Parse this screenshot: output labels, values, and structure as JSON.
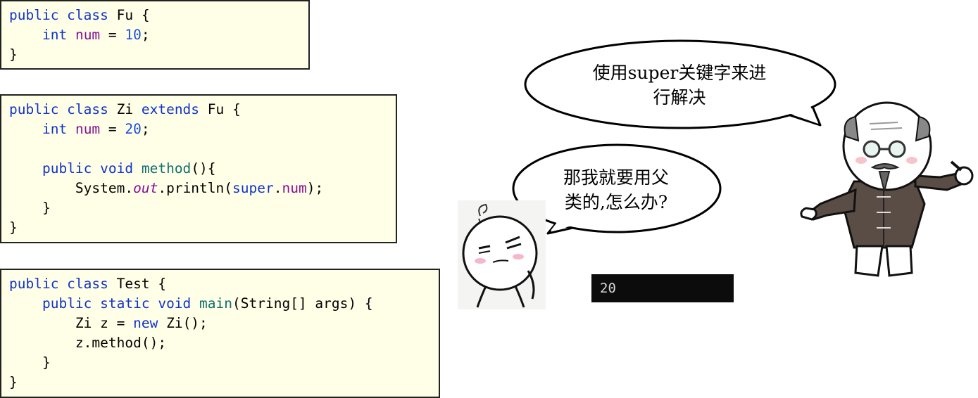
{
  "code_blocks": [
    {
      "id": "fu",
      "lines": [
        [
          [
            "public class",
            "kw"
          ],
          [
            " Fu {",
            "plain"
          ]
        ],
        [
          [
            "    ",
            "plain"
          ],
          [
            "int",
            "kw"
          ],
          [
            " ",
            "plain"
          ],
          [
            "num",
            "fld"
          ],
          [
            " = ",
            "plain"
          ],
          [
            "10",
            "num"
          ],
          [
            ";",
            "plain"
          ]
        ],
        [
          [
            "}",
            "plain"
          ]
        ]
      ]
    },
    {
      "id": "zi",
      "lines": [
        [
          [
            "public class",
            "kw"
          ],
          [
            " Zi ",
            "plain"
          ],
          [
            "extends",
            "kw"
          ],
          [
            " Fu {",
            "plain"
          ]
        ],
        [
          [
            "    ",
            "plain"
          ],
          [
            "int",
            "kw"
          ],
          [
            " ",
            "plain"
          ],
          [
            "num",
            "fld"
          ],
          [
            " = ",
            "plain"
          ],
          [
            "20",
            "num"
          ],
          [
            ";",
            "plain"
          ]
        ],
        [
          [
            "",
            "plain"
          ]
        ],
        [
          [
            "    ",
            "plain"
          ],
          [
            "public void",
            "kw"
          ],
          [
            " ",
            "plain"
          ],
          [
            "method",
            "mth"
          ],
          [
            "(){",
            "plain"
          ]
        ],
        [
          [
            "        System.",
            "plain"
          ],
          [
            "out",
            "fld italic"
          ],
          [
            ".println(",
            "plain"
          ],
          [
            "super",
            "kw"
          ],
          [
            ".",
            "plain"
          ],
          [
            "num",
            "fld"
          ],
          [
            ");",
            "plain"
          ]
        ],
        [
          [
            "    }",
            "plain"
          ]
        ],
        [
          [
            "}",
            "plain"
          ]
        ]
      ]
    },
    {
      "id": "test",
      "lines": [
        [
          [
            "public class",
            "kw"
          ],
          [
            " Test {",
            "plain"
          ]
        ],
        [
          [
            "    ",
            "plain"
          ],
          [
            "public static void",
            "kw"
          ],
          [
            " ",
            "plain"
          ],
          [
            "main",
            "mth"
          ],
          [
            "(String[] args) {",
            "plain"
          ]
        ],
        [
          [
            "        Zi z = ",
            "plain"
          ],
          [
            "new",
            "kw"
          ],
          [
            " Zi();",
            "plain"
          ]
        ],
        [
          [
            "        z.method();",
            "plain"
          ]
        ],
        [
          [
            "    }",
            "plain"
          ]
        ],
        [
          [
            "}",
            "plain"
          ]
        ]
      ]
    }
  ],
  "console_output": "20",
  "bubbles": {
    "student_line1": "那我就要用父",
    "student_line2": "类的,怎么办?",
    "teacher_line1": "使用super关键字来进",
    "teacher_line2": "行解决"
  },
  "colors": {
    "keyword": "#1033c8",
    "field": "#8a0e94",
    "number": "#1a4fe0",
    "method": "#0f6e6e",
    "code_background": "#ffffe8",
    "console_background": "#0c0c0c"
  }
}
